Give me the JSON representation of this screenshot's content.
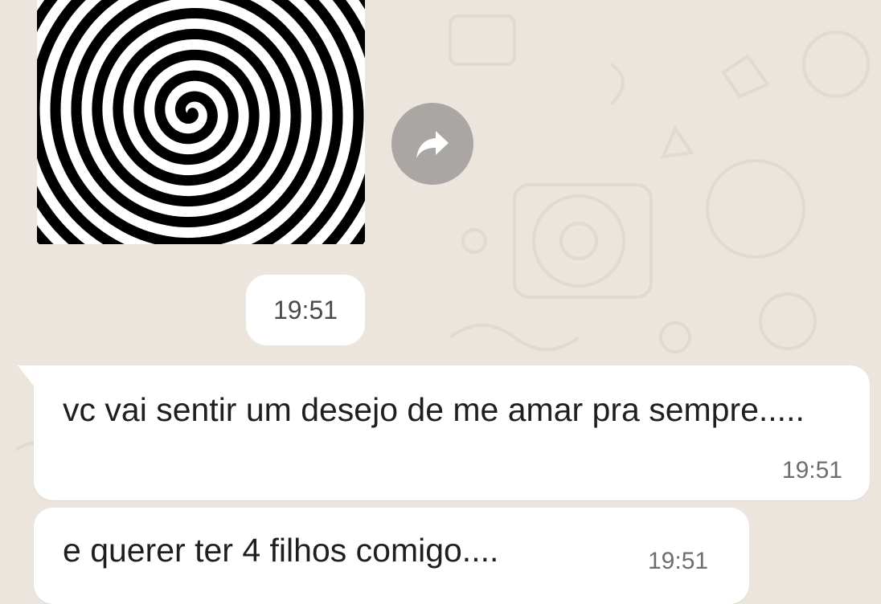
{
  "chat": {
    "messages": [
      {
        "type": "image",
        "image_subject": "black-and-white hypnotic spiral",
        "forward_icon": "forward-arrow-icon"
      },
      {
        "type": "timestamp",
        "time": "19:51"
      },
      {
        "type": "text",
        "text": "vc vai sentir um desejo de me amar pra sempre.....",
        "time": "19:51"
      },
      {
        "type": "text",
        "text": "e querer ter 4 filhos comigo....",
        "time": "19:51"
      }
    ]
  },
  "colors": {
    "wallpaper": "#ece5dd",
    "bubble": "#ffffff",
    "forward_button": "#a9a6a3",
    "text": "#1f1f1f",
    "time_text": "#6e6e6e"
  }
}
